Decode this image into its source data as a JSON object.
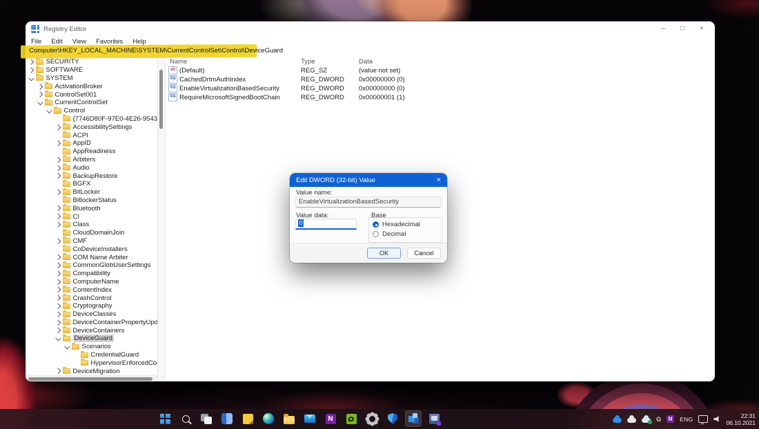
{
  "window": {
    "title": "Registry Editor",
    "controls": {
      "minimize": "–",
      "maximize": "□",
      "close": "×"
    },
    "menu": [
      "File",
      "Edit",
      "View",
      "Favorites",
      "Help"
    ],
    "address": "Computer\\HKEY_LOCAL_MACHINE\\SYSTEM\\CurrentControlSet\\Control\\DeviceGuard"
  },
  "colors": {
    "accent_blue": "#0f62d6",
    "highlight_yellow": "#f0d321",
    "tree_selection_gray": "#d3d3d3",
    "folder_yellow": "#efbc3f"
  },
  "tree": {
    "items": [
      {
        "label": "SECURITY",
        "level": 0,
        "state": "collapsed"
      },
      {
        "label": "SOFTWARE",
        "level": 0,
        "state": "collapsed"
      },
      {
        "label": "SYSTEM",
        "level": 0,
        "state": "expanded"
      },
      {
        "label": "ActivationBroker",
        "level": 1,
        "state": "collapsed"
      },
      {
        "label": "ControlSet001",
        "level": 1,
        "state": "collapsed"
      },
      {
        "label": "CurrentControlSet",
        "level": 1,
        "state": "expanded"
      },
      {
        "label": "Control",
        "level": 2,
        "state": "expanded"
      },
      {
        "label": "{7746D80F-97E0-4E26-9543-",
        "level": 3,
        "state": "none"
      },
      {
        "label": "AccessibilitySettings",
        "level": 3,
        "state": "collapsed"
      },
      {
        "label": "ACPI",
        "level": 3,
        "state": "none"
      },
      {
        "label": "AppID",
        "level": 3,
        "state": "collapsed"
      },
      {
        "label": "AppReadiness",
        "level": 3,
        "state": "none"
      },
      {
        "label": "Arbiters",
        "level": 3,
        "state": "collapsed"
      },
      {
        "label": "Audio",
        "level": 3,
        "state": "collapsed"
      },
      {
        "label": "BackupRestore",
        "level": 3,
        "state": "collapsed"
      },
      {
        "label": "BGFX",
        "level": 3,
        "state": "none"
      },
      {
        "label": "BitLocker",
        "level": 3,
        "state": "collapsed"
      },
      {
        "label": "BitlockerStatus",
        "level": 3,
        "state": "none"
      },
      {
        "label": "Bluetooth",
        "level": 3,
        "state": "collapsed"
      },
      {
        "label": "CI",
        "level": 3,
        "state": "collapsed"
      },
      {
        "label": "Class",
        "level": 3,
        "state": "collapsed"
      },
      {
        "label": "CloudDomainJoin",
        "level": 3,
        "state": "none"
      },
      {
        "label": "CMF",
        "level": 3,
        "state": "collapsed"
      },
      {
        "label": "CoDeviceInstallers",
        "level": 3,
        "state": "none"
      },
      {
        "label": "COM Name Arbiter",
        "level": 3,
        "state": "collapsed"
      },
      {
        "label": "CommonGlobUserSettings",
        "level": 3,
        "state": "collapsed"
      },
      {
        "label": "Compatibility",
        "level": 3,
        "state": "collapsed"
      },
      {
        "label": "ComputerName",
        "level": 3,
        "state": "collapsed"
      },
      {
        "label": "ContentIndex",
        "level": 3,
        "state": "collapsed"
      },
      {
        "label": "CrashControl",
        "level": 3,
        "state": "collapsed"
      },
      {
        "label": "Cryptography",
        "level": 3,
        "state": "collapsed"
      },
      {
        "label": "DeviceClasses",
        "level": 3,
        "state": "collapsed"
      },
      {
        "label": "DeviceContainerPropertyUpd",
        "level": 3,
        "state": "collapsed"
      },
      {
        "label": "DeviceContainers",
        "level": 3,
        "state": "collapsed"
      },
      {
        "label": "DeviceGuard",
        "level": 3,
        "state": "expanded",
        "selected": true
      },
      {
        "label": "Scenarios",
        "level": 4,
        "state": "expanded"
      },
      {
        "label": "CredentialGuard",
        "level": 5,
        "state": "none"
      },
      {
        "label": "HypervisorEnforcedCod",
        "level": 5,
        "state": "none"
      },
      {
        "label": "DeviceMigration",
        "level": 3,
        "state": "collapsed"
      }
    ]
  },
  "list": {
    "columns": [
      "Name",
      "Type",
      "Data"
    ],
    "rows": [
      {
        "name": "(Default)",
        "type": "REG_SZ",
        "data": "(value not set)",
        "icon": "string"
      },
      {
        "name": "CachedDrtmAuthIndex",
        "type": "REG_DWORD",
        "data": "0x00000000 (0)",
        "icon": "dword"
      },
      {
        "name": "EnableVirtualizationBasedSecurity",
        "type": "REG_DWORD",
        "data": "0x00000000 (0)",
        "icon": "dword"
      },
      {
        "name": "RequireMicrosoftSignedBootChain",
        "type": "REG_DWORD",
        "data": "0x00000001 (1)",
        "icon": "dword"
      }
    ]
  },
  "dialog": {
    "title": "Edit DWORD (32-bit) Value",
    "close_glyph": "×",
    "value_name_label": "Value name:",
    "value_name": "EnableVirtualizationBasedSecurity",
    "value_data_label": "Value data:",
    "value_data": "0",
    "base_label": "Base",
    "radio_hexadecimal": "Hexadecimal",
    "radio_decimal": "Decimal",
    "ok_label": "OK",
    "cancel_label": "Cancel"
  },
  "taskbar": {
    "tray": {
      "language": "ENG"
    },
    "clock": {
      "time": "22:31",
      "date": "06.10.2021"
    }
  }
}
